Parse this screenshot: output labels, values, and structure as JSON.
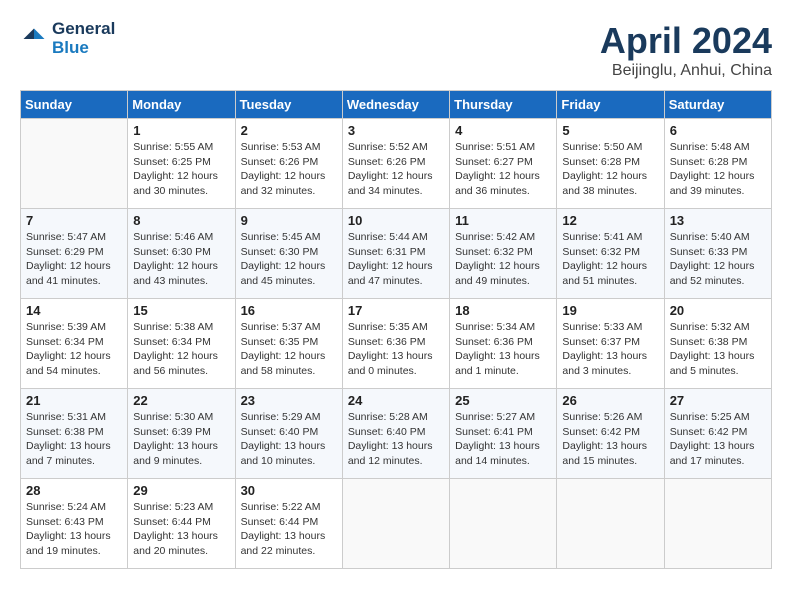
{
  "header": {
    "logo_line1": "General",
    "logo_line2": "Blue",
    "month": "April 2024",
    "location": "Beijinglu, Anhui, China"
  },
  "weekdays": [
    "Sunday",
    "Monday",
    "Tuesday",
    "Wednesday",
    "Thursday",
    "Friday",
    "Saturday"
  ],
  "weeks": [
    [
      {
        "day": "",
        "empty": true
      },
      {
        "day": "1",
        "sunrise": "5:55 AM",
        "sunset": "6:25 PM",
        "daylight": "12 hours and 30 minutes."
      },
      {
        "day": "2",
        "sunrise": "5:53 AM",
        "sunset": "6:26 PM",
        "daylight": "12 hours and 32 minutes."
      },
      {
        "day": "3",
        "sunrise": "5:52 AM",
        "sunset": "6:26 PM",
        "daylight": "12 hours and 34 minutes."
      },
      {
        "day": "4",
        "sunrise": "5:51 AM",
        "sunset": "6:27 PM",
        "daylight": "12 hours and 36 minutes."
      },
      {
        "day": "5",
        "sunrise": "5:50 AM",
        "sunset": "6:28 PM",
        "daylight": "12 hours and 38 minutes."
      },
      {
        "day": "6",
        "sunrise": "5:48 AM",
        "sunset": "6:28 PM",
        "daylight": "12 hours and 39 minutes."
      }
    ],
    [
      {
        "day": "7",
        "sunrise": "5:47 AM",
        "sunset": "6:29 PM",
        "daylight": "12 hours and 41 minutes."
      },
      {
        "day": "8",
        "sunrise": "5:46 AM",
        "sunset": "6:30 PM",
        "daylight": "12 hours and 43 minutes."
      },
      {
        "day": "9",
        "sunrise": "5:45 AM",
        "sunset": "6:30 PM",
        "daylight": "12 hours and 45 minutes."
      },
      {
        "day": "10",
        "sunrise": "5:44 AM",
        "sunset": "6:31 PM",
        "daylight": "12 hours and 47 minutes."
      },
      {
        "day": "11",
        "sunrise": "5:42 AM",
        "sunset": "6:32 PM",
        "daylight": "12 hours and 49 minutes."
      },
      {
        "day": "12",
        "sunrise": "5:41 AM",
        "sunset": "6:32 PM",
        "daylight": "12 hours and 51 minutes."
      },
      {
        "day": "13",
        "sunrise": "5:40 AM",
        "sunset": "6:33 PM",
        "daylight": "12 hours and 52 minutes."
      }
    ],
    [
      {
        "day": "14",
        "sunrise": "5:39 AM",
        "sunset": "6:34 PM",
        "daylight": "12 hours and 54 minutes."
      },
      {
        "day": "15",
        "sunrise": "5:38 AM",
        "sunset": "6:34 PM",
        "daylight": "12 hours and 56 minutes."
      },
      {
        "day": "16",
        "sunrise": "5:37 AM",
        "sunset": "6:35 PM",
        "daylight": "12 hours and 58 minutes."
      },
      {
        "day": "17",
        "sunrise": "5:35 AM",
        "sunset": "6:36 PM",
        "daylight": "13 hours and 0 minutes."
      },
      {
        "day": "18",
        "sunrise": "5:34 AM",
        "sunset": "6:36 PM",
        "daylight": "13 hours and 1 minute."
      },
      {
        "day": "19",
        "sunrise": "5:33 AM",
        "sunset": "6:37 PM",
        "daylight": "13 hours and 3 minutes."
      },
      {
        "day": "20",
        "sunrise": "5:32 AM",
        "sunset": "6:38 PM",
        "daylight": "13 hours and 5 minutes."
      }
    ],
    [
      {
        "day": "21",
        "sunrise": "5:31 AM",
        "sunset": "6:38 PM",
        "daylight": "13 hours and 7 minutes."
      },
      {
        "day": "22",
        "sunrise": "5:30 AM",
        "sunset": "6:39 PM",
        "daylight": "13 hours and 9 minutes."
      },
      {
        "day": "23",
        "sunrise": "5:29 AM",
        "sunset": "6:40 PM",
        "daylight": "13 hours and 10 minutes."
      },
      {
        "day": "24",
        "sunrise": "5:28 AM",
        "sunset": "6:40 PM",
        "daylight": "13 hours and 12 minutes."
      },
      {
        "day": "25",
        "sunrise": "5:27 AM",
        "sunset": "6:41 PM",
        "daylight": "13 hours and 14 minutes."
      },
      {
        "day": "26",
        "sunrise": "5:26 AM",
        "sunset": "6:42 PM",
        "daylight": "13 hours and 15 minutes."
      },
      {
        "day": "27",
        "sunrise": "5:25 AM",
        "sunset": "6:42 PM",
        "daylight": "13 hours and 17 minutes."
      }
    ],
    [
      {
        "day": "28",
        "sunrise": "5:24 AM",
        "sunset": "6:43 PM",
        "daylight": "13 hours and 19 minutes."
      },
      {
        "day": "29",
        "sunrise": "5:23 AM",
        "sunset": "6:44 PM",
        "daylight": "13 hours and 20 minutes."
      },
      {
        "day": "30",
        "sunrise": "5:22 AM",
        "sunset": "6:44 PM",
        "daylight": "13 hours and 22 minutes."
      },
      {
        "day": "",
        "empty": true
      },
      {
        "day": "",
        "empty": true
      },
      {
        "day": "",
        "empty": true
      },
      {
        "day": "",
        "empty": true
      }
    ]
  ],
  "labels": {
    "sunrise": "Sunrise:",
    "sunset": "Sunset:",
    "daylight": "Daylight:"
  }
}
